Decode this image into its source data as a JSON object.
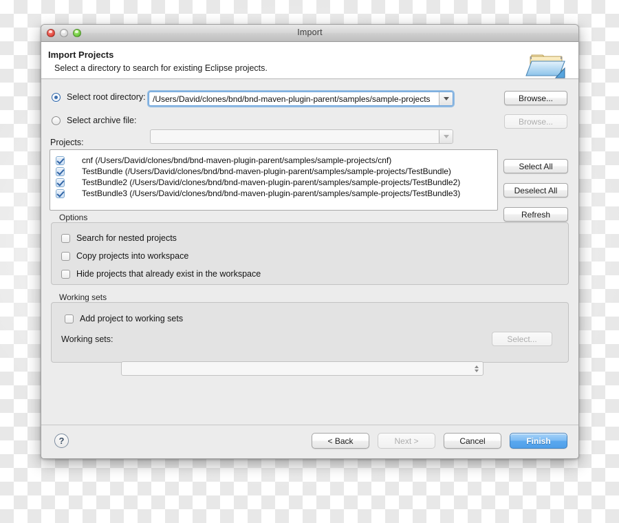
{
  "window": {
    "title": "Import",
    "traffic_lights": [
      "close-red",
      "minimize-disabled",
      "zoom-green"
    ]
  },
  "header": {
    "title": "Import Projects",
    "subtitle": "Select a directory to search for existing Eclipse projects.",
    "icon": "import-folder-icon"
  },
  "source": {
    "root_directory": {
      "label": "Select root directory:",
      "value": "/Users/David/clones/bnd/bnd-maven-plugin-parent/samples/sample-projects",
      "selected": true,
      "browse_label": "Browse...",
      "browse_enabled": true
    },
    "archive_file": {
      "label": "Select archive file:",
      "value": "",
      "selected": false,
      "browse_label": "Browse...",
      "browse_enabled": false
    }
  },
  "projects": {
    "label": "Projects:",
    "items": [
      {
        "name": "cnf (/Users/David/clones/bnd/bnd-maven-plugin-parent/samples/sample-projects/cnf)",
        "checked": true
      },
      {
        "name": "TestBundle (/Users/David/clones/bnd/bnd-maven-plugin-parent/samples/sample-projects/TestBundle)",
        "checked": true
      },
      {
        "name": "TestBundle2 (/Users/David/clones/bnd/bnd-maven-plugin-parent/samples/sample-projects/TestBundle2)",
        "checked": true
      },
      {
        "name": "TestBundle3 (/Users/David/clones/bnd/bnd-maven-plugin-parent/samples/sample-projects/TestBundle3)",
        "checked": true
      }
    ],
    "select_all_label": "Select All",
    "deselect_all_label": "Deselect All",
    "refresh_label": "Refresh"
  },
  "options": {
    "title": "Options",
    "items": [
      {
        "label": "Search for nested projects",
        "checked": false
      },
      {
        "label": "Copy projects into workspace",
        "checked": false
      },
      {
        "label": "Hide projects that already exist in the workspace",
        "checked": false
      }
    ]
  },
  "working_sets": {
    "title": "Working sets",
    "add_label": "Add project to working sets",
    "add_checked": false,
    "combo_label": "Working sets:",
    "combo_value": "",
    "select_label": "Select...",
    "select_enabled": false
  },
  "footer": {
    "help_label": "?",
    "back_label": "< Back",
    "next_label": "Next >",
    "cancel_label": "Cancel",
    "finish_label": "Finish",
    "back_enabled": true,
    "next_enabled": false,
    "cancel_enabled": true,
    "finish_enabled": true
  },
  "colors": {
    "accent_blue": "#5aa8ef",
    "focus_ring": "#6aa2dc",
    "dialog_bg": "#ececec",
    "group_bg": "#e3e3e3"
  }
}
